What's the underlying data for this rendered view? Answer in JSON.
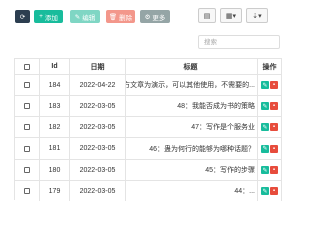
{
  "toolbar": {
    "refresh_icon": "refresh-icon",
    "add_label": "添加",
    "edit_label": "编辑",
    "delete_label": "删除",
    "more_label": "更多"
  },
  "right_tools": {
    "icons": [
      "columns-icon",
      "grid-icon",
      "export-icon"
    ]
  },
  "search": {
    "placeholder": "搜索"
  },
  "table": {
    "headers": {
      "id": "Id",
      "date": "日期",
      "title": "标题",
      "ops": "操作"
    },
    "rows": [
      {
        "id": "184",
        "date": "2022-04-22",
        "title": "下方文章为演示，可以其他使用，不需要的..."
      },
      {
        "id": "183",
        "date": "2022-03-05",
        "title": "48：我能否成为书的策略"
      },
      {
        "id": "182",
        "date": "2022-03-05",
        "title": "47：写作是个服务业"
      },
      {
        "id": "181",
        "date": "2022-03-05",
        "title": "46：蛊为何行的能够为哪种话题？"
      },
      {
        "id": "180",
        "date": "2022-03-05",
        "title": "45：写作的步骤"
      },
      {
        "id": "179",
        "date": "2022-03-05",
        "title": "44：..."
      }
    ]
  },
  "colors": {
    "primary_dark": "#2c3e50",
    "success": "#18bc9c",
    "danger": "#e74c3c",
    "muted": "#95a5a6"
  }
}
